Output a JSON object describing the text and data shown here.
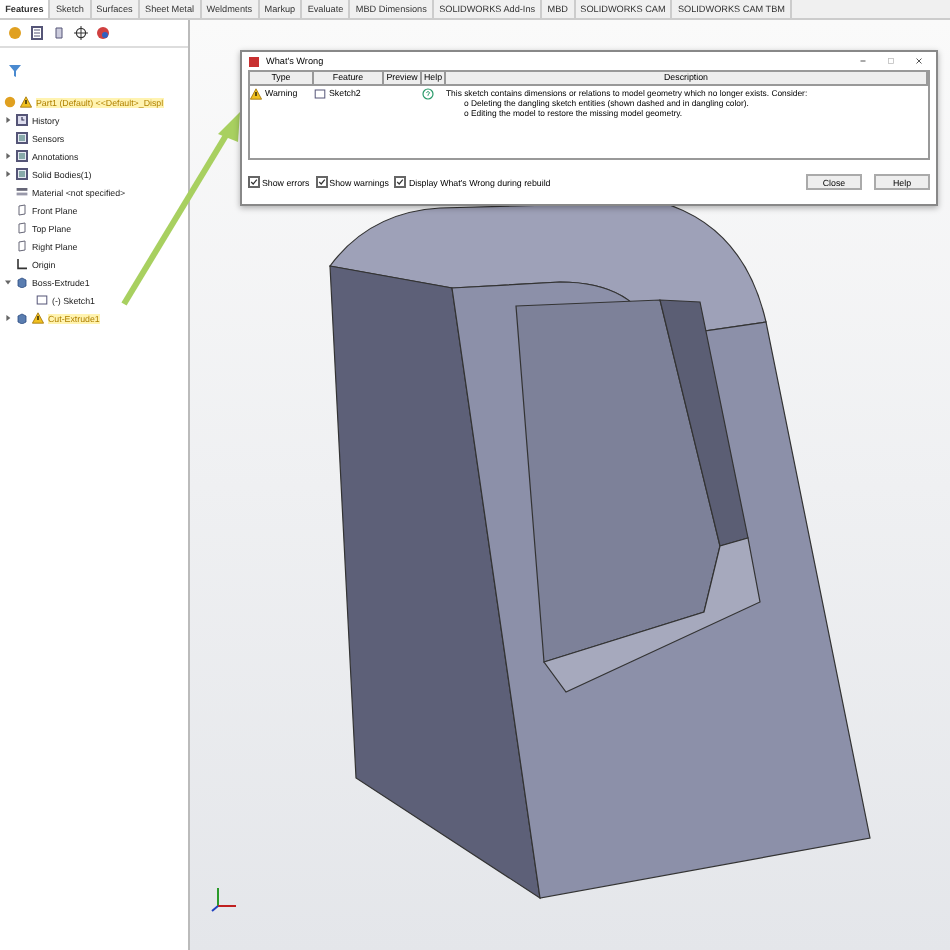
{
  "tabs": [
    {
      "label": "Features",
      "selected": true
    },
    {
      "label": "Sketch",
      "selected": false
    },
    {
      "label": "Surfaces",
      "selected": false
    },
    {
      "label": "Sheet Metal",
      "selected": false
    },
    {
      "label": "Weldments",
      "selected": false
    },
    {
      "label": "Markup",
      "selected": false
    },
    {
      "label": "Evaluate",
      "selected": false
    },
    {
      "label": "MBD Dimensions",
      "selected": false
    },
    {
      "label": "SOLIDWORKS Add-Ins",
      "selected": false
    },
    {
      "label": "MBD",
      "selected": false
    },
    {
      "label": "SOLIDWORKS CAM",
      "selected": false
    },
    {
      "label": "SOLIDWORKS CAM TBM",
      "selected": false
    }
  ],
  "tree": {
    "root": {
      "label": "Part1 (Default) <<Default>_Displ",
      "warning": true
    },
    "items": [
      {
        "label": "History",
        "kind": "history",
        "expanded": false,
        "warning": false
      },
      {
        "label": "Sensors",
        "kind": "folder",
        "warning": false
      },
      {
        "label": "Annotations",
        "kind": "folder",
        "expanded": false,
        "warning": false
      },
      {
        "label": "Solid Bodies(1)",
        "kind": "folder",
        "expanded": false,
        "warning": false
      },
      {
        "label": "Material <not specified>",
        "kind": "material",
        "warning": false
      },
      {
        "label": "Front Plane",
        "kind": "plane",
        "warning": false
      },
      {
        "label": "Top Plane",
        "kind": "plane",
        "warning": false
      },
      {
        "label": "Right Plane",
        "kind": "plane",
        "warning": false
      },
      {
        "label": "Origin",
        "kind": "origin",
        "warning": false
      },
      {
        "label": "Boss-Extrude1",
        "kind": "feature",
        "expanded": true,
        "warning": false,
        "children": [
          {
            "label": "(-) Sketch1",
            "kind": "sketch",
            "warning": false
          }
        ]
      },
      {
        "label": "Cut-Extrude1",
        "kind": "feature",
        "expanded": false,
        "warning": true
      }
    ]
  },
  "dialog": {
    "title": "What's Wrong",
    "columns": [
      "Type",
      "Feature",
      "Preview",
      "Help",
      "Description"
    ],
    "rows": [
      {
        "type": "Warning",
        "feature": "Sketch2",
        "description": [
          "This sketch contains dimensions or relations to model geometry which no longer exists.  Consider:",
          "o Deleting the dangling sketch entities (shown dashed and in dangling color).",
          "o Editing the model to restore the missing model geometry."
        ]
      }
    ],
    "options": [
      {
        "label": "Show errors",
        "checked": true
      },
      {
        "label": "Show warnings",
        "checked": true
      },
      {
        "label": "Display What's Wrong during rebuild",
        "checked": true
      }
    ],
    "buttons": [
      "Close",
      "Help"
    ]
  }
}
